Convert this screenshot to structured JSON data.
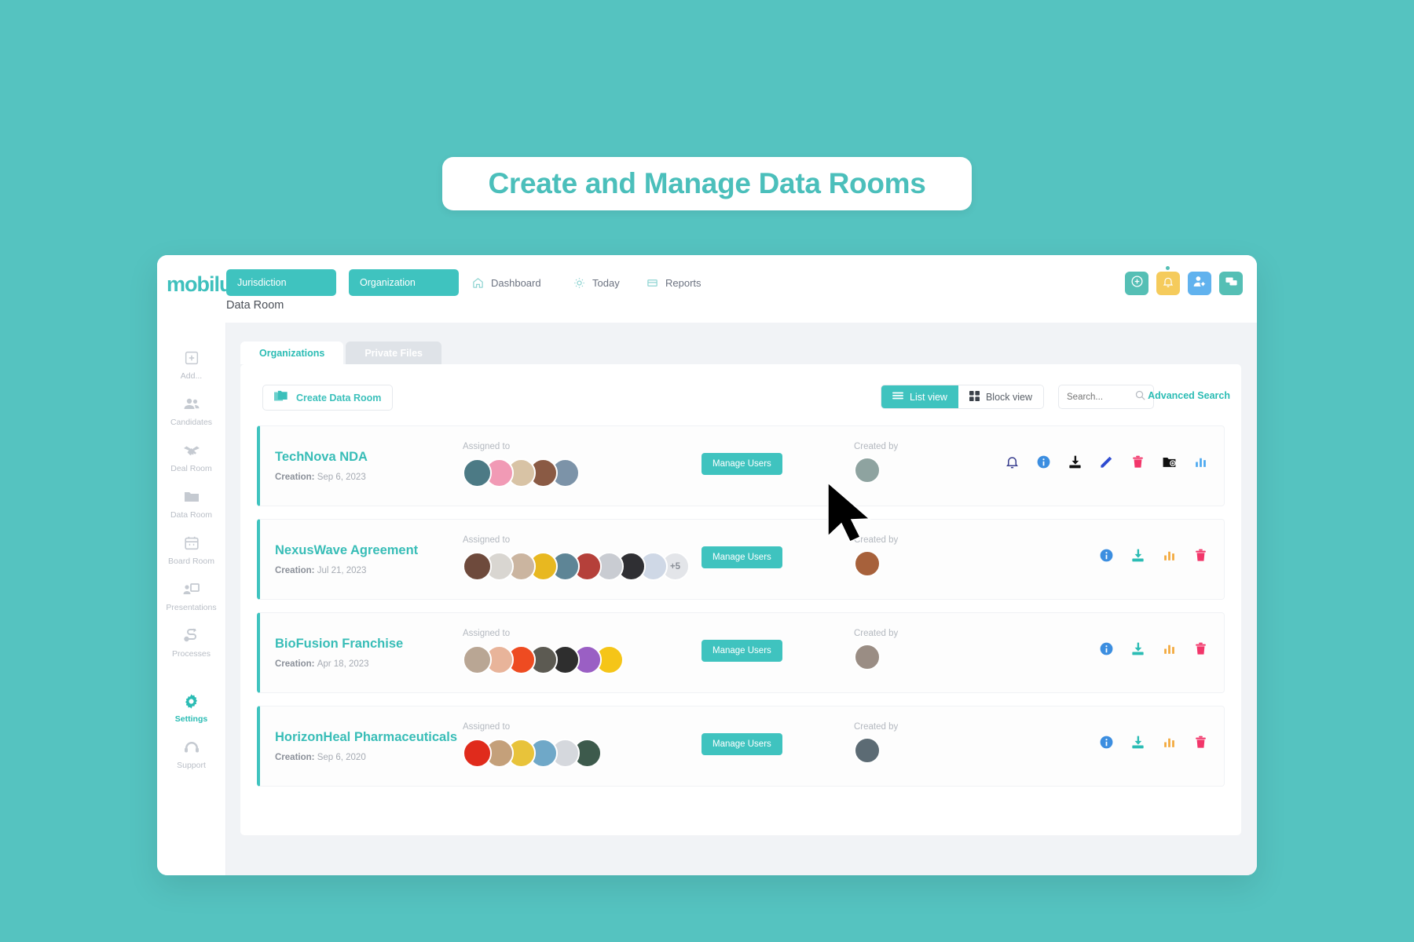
{
  "headline": {
    "text": "Create and Manage Data Rooms"
  },
  "brand": {
    "logo": "mobilu",
    "accent": "#3fc3bf",
    "page_background": "#55c3c0"
  },
  "topbar": {
    "pills": [
      {
        "label": "Jurisdiction",
        "name": "jurisdiction-selector"
      },
      {
        "label": "Organization",
        "name": "organization-selector"
      }
    ],
    "nav": [
      {
        "label": "Dashboard",
        "icon": "home-icon"
      },
      {
        "label": "Today",
        "icon": "sun-icon"
      },
      {
        "label": "Reports",
        "icon": "reports-icon"
      }
    ],
    "actions": [
      {
        "name": "add-button",
        "icon": "plus-circle-icon",
        "color": "#55bfb5"
      },
      {
        "name": "notifications-button",
        "icon": "bell-icon",
        "color": "#f5cb5c",
        "badge": true
      },
      {
        "name": "user-settings-button",
        "icon": "user-gear-icon",
        "color": "#61b2ee"
      },
      {
        "name": "messages-button",
        "icon": "chat-icon",
        "color": "#55bfb5"
      }
    ]
  },
  "breadcrumb": "Data Room",
  "sidebar": {
    "items": [
      {
        "label": "Add...",
        "icon": "plus-square-icon",
        "active": false
      },
      {
        "label": "Candidates",
        "icon": "people-icon",
        "active": false
      },
      {
        "label": "Deal Room",
        "icon": "handshake-icon",
        "active": false
      },
      {
        "label": "Data Room",
        "icon": "folder-icon",
        "active": false
      },
      {
        "label": "Board Room",
        "icon": "calendar-icon",
        "active": false
      },
      {
        "label": "Presentations",
        "icon": "presentation-icon",
        "active": false
      },
      {
        "label": "Processes",
        "icon": "route-icon",
        "active": false
      },
      {
        "label": "Settings",
        "icon": "gear-icon",
        "active": true
      },
      {
        "label": "Support",
        "icon": "headset-icon",
        "active": false
      }
    ]
  },
  "tabs": [
    {
      "label": "Organizations",
      "active": true
    },
    {
      "label": "Private Files",
      "active": false
    }
  ],
  "toolbar": {
    "create_label": "Create Data Room",
    "create_icon": "folders-icon",
    "list_view_label": "List view",
    "block_view_label": "Block view",
    "search_placeholder": "Search...",
    "search_value": "",
    "advanced_search_label": "Advanced Search"
  },
  "labels": {
    "assigned_to": "Assigned to",
    "created_by": "Created by",
    "creation_prefix": "Creation:",
    "manage_users": "Manage Users"
  },
  "rows": [
    {
      "title": "TechNova NDA",
      "creation_date": "Sep 6, 2023",
      "assigned_count": 5,
      "overflow": "",
      "avatar_colors": [
        "#4c7a85",
        "#f19ab5",
        "#d8c3a5",
        "#8a5a44",
        "#7c93a8"
      ],
      "creator_color": "#8ea3a0",
      "actions": [
        {
          "name": "notify-icon",
          "glyph": "bell",
          "color": "#3a3f8f"
        },
        {
          "name": "info-icon",
          "glyph": "info",
          "color": "#3c8ee0"
        },
        {
          "name": "download-icon",
          "glyph": "download",
          "color": "#111111"
        },
        {
          "name": "edit-icon",
          "glyph": "pencil",
          "color": "#2d4bd1"
        },
        {
          "name": "delete-icon",
          "glyph": "trash",
          "color": "#f2366a"
        },
        {
          "name": "add-folder-icon",
          "glyph": "folder-plus",
          "color": "#111111"
        },
        {
          "name": "statistics-icon",
          "glyph": "chart",
          "color": "#4aa8ef"
        }
      ]
    },
    {
      "title": "NexusWave Agreement",
      "creation_date": "Jul 21, 2023",
      "assigned_count": 9,
      "overflow": "+5",
      "avatar_colors": [
        "#6e4a3c",
        "#d9d6d1",
        "#cbb5a0",
        "#e8b820",
        "#5e8596",
        "#b5403a",
        "#c9ccd2",
        "#2f2f33",
        "#cfd8e6"
      ],
      "creator_color": "#a7613b",
      "actions": [
        {
          "name": "info-icon",
          "glyph": "info",
          "color": "#3c8ee0"
        },
        {
          "name": "download-icon",
          "glyph": "download",
          "color": "#2bbcb4"
        },
        {
          "name": "statistics-icon",
          "glyph": "chart",
          "color": "#f2a83b"
        },
        {
          "name": "delete-icon",
          "glyph": "trash",
          "color": "#f2366a"
        }
      ]
    },
    {
      "title": "BioFusion Franchise",
      "creation_date": "Apr 18, 2023",
      "assigned_count": 7,
      "overflow": "",
      "avatar_colors": [
        "#b9a694",
        "#e8b49a",
        "#ee4b21",
        "#5c5a52",
        "#2e2e2e",
        "#9a5fc4",
        "#f5c518"
      ],
      "creator_color": "#9a8d84",
      "actions": [
        {
          "name": "info-icon",
          "glyph": "info",
          "color": "#3c8ee0"
        },
        {
          "name": "download-icon",
          "glyph": "download",
          "color": "#2bbcb4"
        },
        {
          "name": "statistics-icon",
          "glyph": "chart",
          "color": "#f2a83b"
        },
        {
          "name": "delete-icon",
          "glyph": "trash",
          "color": "#f2366a"
        }
      ]
    },
    {
      "title": "HorizonHeal Pharmaceuticals",
      "creation_date": "Sep 6, 2020",
      "assigned_count": 6,
      "overflow": "",
      "avatar_colors": [
        "#e02b1c",
        "#c4a07a",
        "#e8c33a",
        "#6fa8c8",
        "#d5d8dd",
        "#3d5a4c"
      ],
      "creator_color": "#5c6b74",
      "actions": [
        {
          "name": "info-icon",
          "glyph": "info",
          "color": "#3c8ee0"
        },
        {
          "name": "download-icon",
          "glyph": "download",
          "color": "#2bbcb4"
        },
        {
          "name": "statistics-icon",
          "glyph": "chart",
          "color": "#f2a83b"
        },
        {
          "name": "delete-icon",
          "glyph": "trash",
          "color": "#f2366a"
        }
      ]
    }
  ]
}
